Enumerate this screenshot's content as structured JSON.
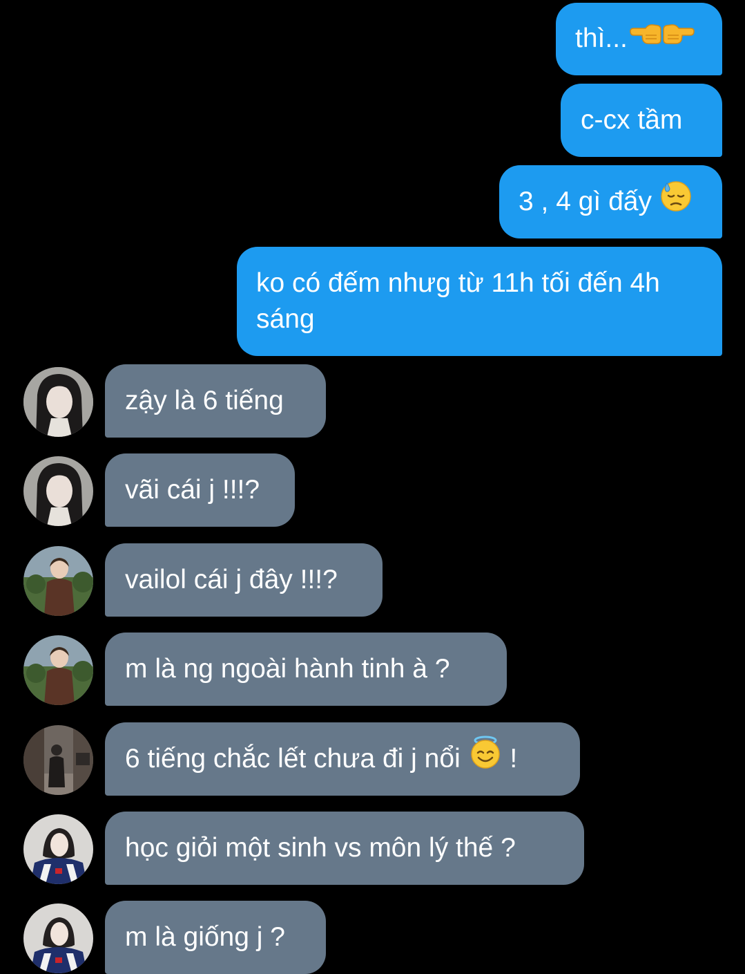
{
  "colors": {
    "background": "#000000",
    "outgoing_bubble": "#1d9bf0",
    "incoming_bubble": "#66788a",
    "text": "#ffffff"
  },
  "messages": [
    {
      "side": "out",
      "text": "thì...",
      "emoji": "backhand-index-pointing-left-right-icon"
    },
    {
      "side": "out",
      "text": "c-cx tầm"
    },
    {
      "side": "out",
      "text": "3 , 4 gì đấy",
      "emoji": "downcast-sweat-face-icon"
    },
    {
      "side": "out",
      "text": "ko có đếm nhưg từ 11h tối đến 4h sáng"
    },
    {
      "side": "in",
      "avatar": "avatar-girl-dark-hair",
      "text": "zậy là 6 tiếng"
    },
    {
      "side": "in",
      "avatar": "avatar-girl-dark-hair",
      "text": "vãi cái j !!!?"
    },
    {
      "side": "in",
      "avatar": "avatar-child-brown-jacket",
      "text": "vailol cái j đây !!!?"
    },
    {
      "side": "in",
      "avatar": "avatar-child-brown-jacket",
      "text": "m là ng ngoài hành tinh à ?"
    },
    {
      "side": "in",
      "avatar": "avatar-street-photo",
      "text": "6 tiếng chắc lết chưa đi j nổi",
      "emoji": "smiling-face-with-halo-icon",
      "suffix": "!"
    },
    {
      "side": "in",
      "avatar": "avatar-girl-racing-jacket",
      "text": "học giỏi một sinh vs môn lý thế ?"
    },
    {
      "side": "in",
      "avatar": "avatar-girl-racing-jacket",
      "text": "m là giống j ?"
    }
  ]
}
